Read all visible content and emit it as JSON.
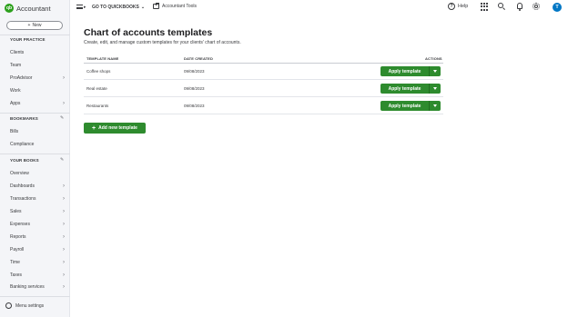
{
  "brand": {
    "name": "Accountant",
    "mark": "qb",
    "accent": "#2ca01c"
  },
  "sidebar": {
    "new_label": "New",
    "sections": [
      {
        "title": "YOUR PRACTICE",
        "items": [
          {
            "label": "Clients",
            "chevron": false
          },
          {
            "label": "Team",
            "chevron": false
          },
          {
            "label": "ProAdvisor",
            "chevron": true
          },
          {
            "label": "Work",
            "chevron": false
          },
          {
            "label": "Apps",
            "chevron": true
          }
        ]
      },
      {
        "title": "BOOKMARKS",
        "items": [
          {
            "label": "Bills",
            "chevron": false
          },
          {
            "label": "Compliance",
            "chevron": false
          }
        ]
      },
      {
        "title": "YOUR BOOKS",
        "items": [
          {
            "label": "Overview",
            "chevron": false
          },
          {
            "label": "Dashboards",
            "chevron": true
          },
          {
            "label": "Transactions",
            "chevron": true
          },
          {
            "label": "Sales",
            "chevron": true
          },
          {
            "label": "Expenses",
            "chevron": true
          },
          {
            "label": "Reports",
            "chevron": true
          },
          {
            "label": "Payroll",
            "chevron": true
          },
          {
            "label": "Time",
            "chevron": true
          },
          {
            "label": "Taxes",
            "chevron": true
          },
          {
            "label": "Banking services",
            "chevron": true
          }
        ]
      }
    ],
    "menu_settings": "Menu settings"
  },
  "topbar": {
    "goto": "GO TO QUICKBOOKS",
    "accountant_tools": "Accountant Tools",
    "help": "Help",
    "avatar_initial": "T"
  },
  "main": {
    "title": "Chart of accounts templates",
    "subtitle": "Create, edit, and manage custom templates for your clients' chart of accounts.",
    "columns": {
      "name": "TEMPLATE NAME",
      "date": "DATE CREATED",
      "actions": "ACTIONS"
    },
    "rows": [
      {
        "name": "Coffee shops",
        "date": "09/08/2023",
        "action": "Apply template"
      },
      {
        "name": "Real estate",
        "date": "09/08/2023",
        "action": "Apply template"
      },
      {
        "name": "Restaurants",
        "date": "09/08/2023",
        "action": "Apply template"
      }
    ],
    "add_button": "Add new template"
  }
}
